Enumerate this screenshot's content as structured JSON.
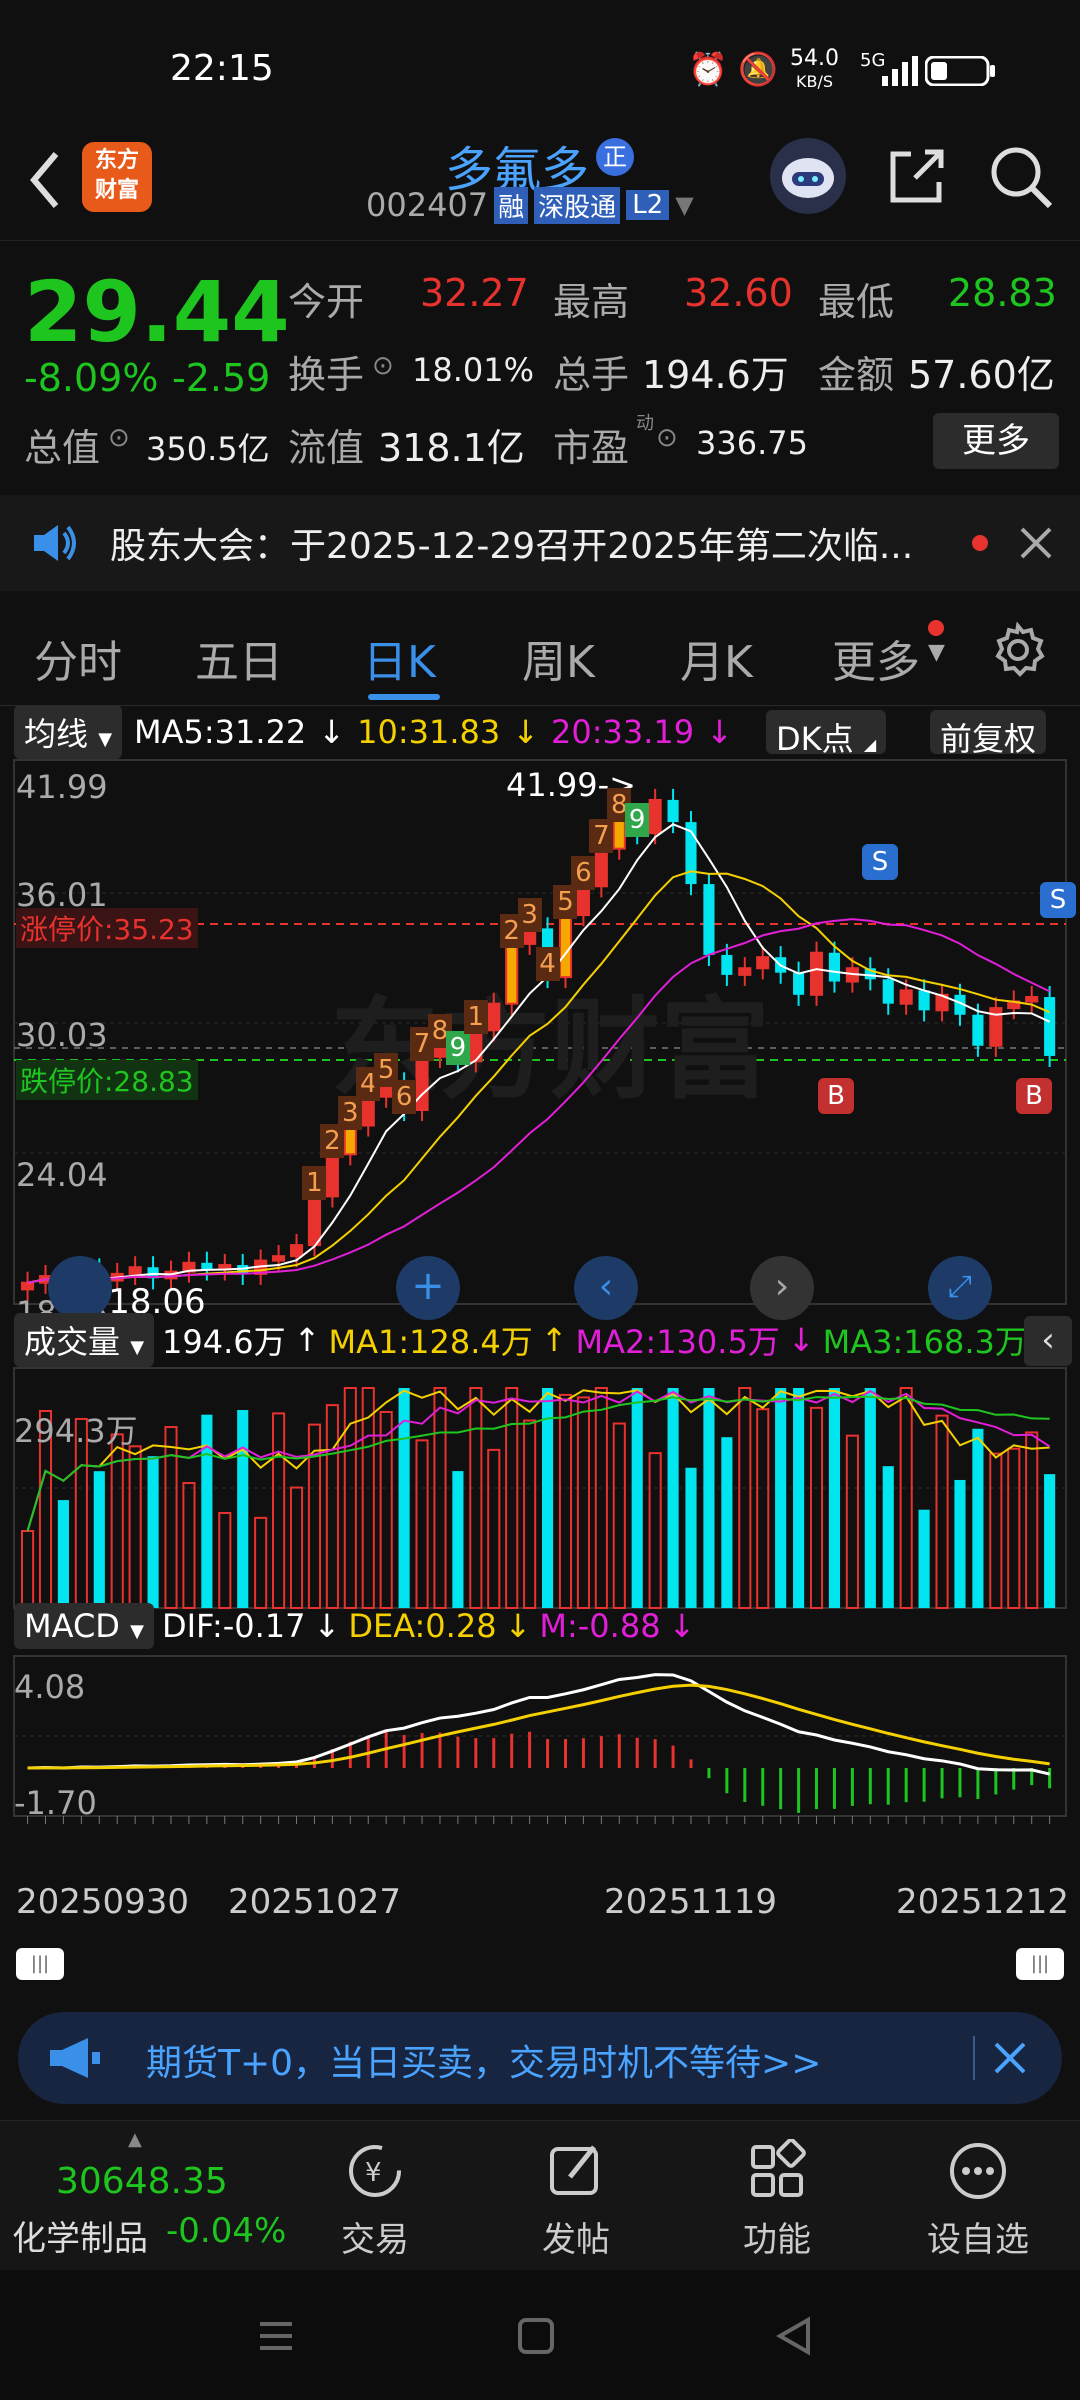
{
  "status": {
    "time": "22:15",
    "net_speed": "54.0",
    "net_unit": "KB/S",
    "signal": "5G"
  },
  "header": {
    "app_logo_line1": "东方",
    "app_logo_line2": "财富",
    "stock_name": "多氟多",
    "badge": "正",
    "code": "002407",
    "tag1": "融",
    "tag2": "深股通",
    "tag3": "L2"
  },
  "quote": {
    "price": "29.44",
    "pct": "-8.09%",
    "chg": "-2.59",
    "open_label": "今开",
    "open": "32.27",
    "high_label": "最高",
    "high": "32.60",
    "low_label": "最低",
    "low": "28.83",
    "turnover_label": "换手",
    "turnover": "18.01%",
    "vol_label": "总手",
    "vol": "194.6万",
    "amount_label": "金额",
    "amount": "57.60亿",
    "mcap_label": "总值",
    "mcap": "350.5亿",
    "float_label": "流值",
    "float": "318.1亿",
    "pe_label": "市盈",
    "pe_sup": "动",
    "pe": "336.75",
    "more": "更多"
  },
  "notice": {
    "text": "股东大会：于2025-12-29召开2025年第二次临..."
  },
  "tabs": [
    "分时",
    "五日",
    "日K",
    "周K",
    "月K",
    "更多"
  ],
  "ma_line": {
    "selector": "均线",
    "ma5": "MA5:31.22",
    "ma10": "10:31.83",
    "ma20": "20:33.19",
    "dk": "DK点",
    "fq": "前复权"
  },
  "kline": {
    "y_labels": [
      "41.99",
      "36.01",
      "30.03",
      "24.04",
      "18.06"
    ],
    "max_label": "41.99->",
    "min_label": "-18.06",
    "limit_up": "涨停价:35.23",
    "limit_down": "跌停价:28.83",
    "seq_numbers": [
      "1",
      "2",
      "3",
      "4",
      "5",
      "6",
      "7",
      "8",
      "9",
      "1",
      "2",
      "3",
      "4",
      "5",
      "6",
      "7",
      "8",
      "9"
    ],
    "signal_b": "B",
    "signal_s": "S"
  },
  "volume": {
    "selector": "成交量",
    "vol": "194.6万",
    "ma1": "MA1:128.4万",
    "ma2": "MA2:130.5万",
    "ma3": "MA3:168.3万",
    "max": "294.3万"
  },
  "macd": {
    "selector": "MACD",
    "dif": "DIF:-0.17",
    "dea": "DEA:0.28",
    "m": "M:-0.88",
    "max": "4.08",
    "min": "-1.70"
  },
  "dates": [
    "20250930",
    "20251027",
    "20251119",
    "20251212"
  ],
  "banner": {
    "text": "期货T+0，当日买卖，交易时机不等待>>"
  },
  "bottom": {
    "index_value": "30648.35",
    "index_name": "化学制品",
    "index_pct": "-0.04%",
    "nav": [
      "交易",
      "发帖",
      "功能",
      "设自选"
    ]
  },
  "colors": {
    "up": "#e8322e",
    "down": "#1fc51f",
    "cyan": "#00e5f0",
    "yellow": "#f5d000",
    "magenta": "#e01fd6",
    "accent": "#3a8fe8"
  }
}
